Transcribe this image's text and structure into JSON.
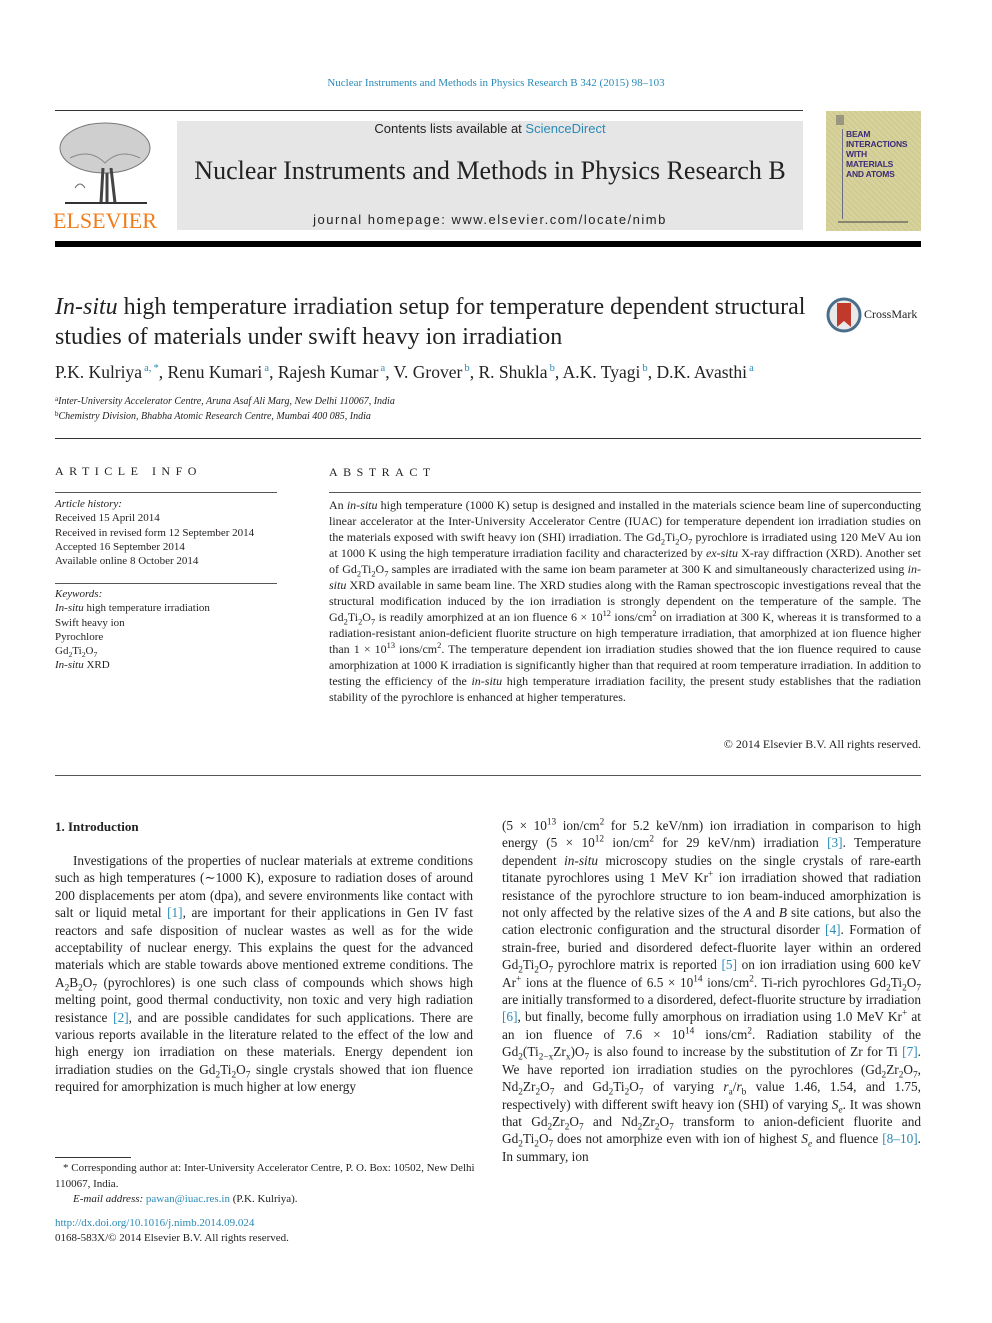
{
  "running_header": "Nuclear Instruments and Methods in Physics Research B 342 (2015) 98–103",
  "masthead": {
    "publisher_logo_text": "ELSEVIER",
    "contents_prefix": "Contents lists available at ",
    "contents_link": "ScienceDirect",
    "journal_title": "Nuclear Instruments and Methods in Physics Research B",
    "homepage": "journal homepage: www.elsevier.com/locate/nimb",
    "cover_title_lines": [
      "BEAM",
      "INTERACTIONS",
      "WITH",
      "MATERIALS",
      "AND ATOMS"
    ]
  },
  "article": {
    "title_italic": "In-situ",
    "title_rest": " high temperature irradiation setup for temperature dependent structural studies of materials under swift heavy ion irradiation",
    "crossmark_label": "CrossMark",
    "authors": [
      {
        "name": "P.K. Kulriya",
        "aff": "a,*"
      },
      {
        "name": "Renu Kumari",
        "aff": "a"
      },
      {
        "name": "Rajesh Kumar",
        "aff": "a"
      },
      {
        "name": "V. Grover",
        "aff": "b"
      },
      {
        "name": "R. Shukla",
        "aff": "b"
      },
      {
        "name": "A.K. Tyagi",
        "aff": "b"
      },
      {
        "name": "D.K. Avasthi",
        "aff": "a"
      }
    ],
    "affiliations": [
      {
        "key": "a",
        "text": "Inter-University Accelerator Centre, Aruna Asaf Ali Marg, New Delhi 110067, India"
      },
      {
        "key": "b",
        "text": "Chemistry Division, Bhabha Atomic Research Centre, Mumbai 400 085, India"
      }
    ]
  },
  "article_info": {
    "heading": "ARTICLE INFO",
    "history_label": "Article history:",
    "history": [
      "Received 15 April 2014",
      "Received in revised form 12 September 2014",
      "Accepted 16 September 2014",
      "Available online 8 October 2014"
    ],
    "keywords_label": "Keywords:",
    "keywords": [
      {
        "italic": "In-situ",
        "rest": " high temperature irradiation"
      },
      {
        "italic": "",
        "rest": "Swift heavy ion"
      },
      {
        "italic": "",
        "rest": "Pyrochlore"
      },
      {
        "italic": "",
        "rest": "Gd2Ti2O7"
      },
      {
        "italic": "In-situ",
        "rest": " XRD"
      }
    ]
  },
  "abstract": {
    "heading": "ABSTRACT",
    "copyright": "© 2014 Elsevier B.V. All rights reserved."
  },
  "introduction": {
    "heading": "1. Introduction"
  },
  "footnote": {
    "corresponding": "* Corresponding author at: Inter-University Accelerator Centre, P. O. Box: 10502, New Delhi 110067, India.",
    "email_label": "E-mail address: ",
    "email": "pawan@iuac.res.in",
    "email_owner": " (P.K. Kulriya).",
    "doi": "http://dx.doi.org/10.1016/j.nimb.2014.09.024",
    "issn": "0168-583X/© 2014 Elsevier B.V. All rights reserved."
  },
  "colors": {
    "link": "#2a8ab8",
    "elsevier_orange": "#f07d1b",
    "masthead_grey": "#e6e6e6"
  }
}
